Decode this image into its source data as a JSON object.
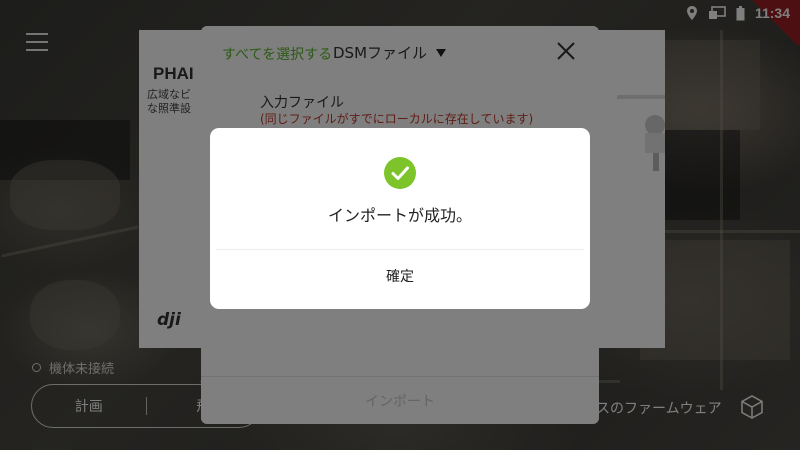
{
  "status_bar": {
    "time": "11:34",
    "icons": [
      "location-icon",
      "cast-icon",
      "battery-icon"
    ]
  },
  "product_card": {
    "title": "PHAI",
    "description_lines": [
      "広域なビ",
      "な照準設"
    ]
  },
  "file_dialog": {
    "select_all": "すべてを選択する",
    "file_type": "DSMファイル",
    "input_label": "入力ファイル",
    "input_note": "(同じファイルがすでにローカルに存在しています)",
    "import_button": "インポート"
  },
  "connection": {
    "status": "機体未接続"
  },
  "mode_switch": {
    "plan": "計画",
    "fly": "飛"
  },
  "firmware": {
    "label": "スのファームウェア"
  },
  "success_modal": {
    "message": "インポートが成功。",
    "confirm": "確定"
  },
  "colors": {
    "accent_green": "#7dc42a",
    "warning_red": "#c0392b",
    "select_green": "#5ab52c"
  }
}
